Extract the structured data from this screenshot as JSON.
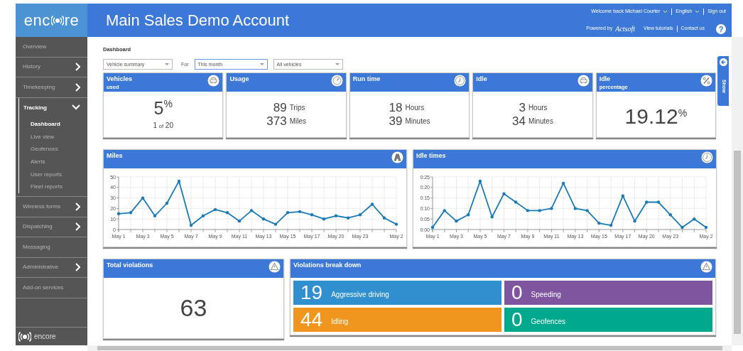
{
  "logo": {
    "text_before": "enc",
    "text_after": "re"
  },
  "title": "Main Sales Demo Account",
  "user_menu": [
    {
      "label": "Welcome back Michael Courter",
      "dropdown": true
    },
    {
      "label": "English",
      "dropdown": true
    },
    {
      "label": "Sign out",
      "dropdown": false
    }
  ],
  "powered_by": {
    "label": "Powered by",
    "brand": "Actsoft"
  },
  "header_links": [
    "View tutorials",
    "Contact us"
  ],
  "help": "?",
  "sidebar": {
    "items": [
      {
        "label": "Overview",
        "selected": false
      },
      {
        "label": "History",
        "expanded": false,
        "selected": false
      },
      {
        "label": "Timekeeping",
        "expanded": false,
        "selected": false
      },
      {
        "label": "Tracking",
        "expanded": true,
        "selected": true,
        "children": [
          {
            "label": "Dashboard",
            "selected": true
          },
          {
            "label": "Live view",
            "selected": false
          },
          {
            "label": "Geofences",
            "selected": false
          },
          {
            "label": "Alerts",
            "selected": false
          },
          {
            "label": "User reports",
            "selected": false
          },
          {
            "label": "Fleet reports",
            "selected": false
          }
        ]
      },
      {
        "label": "Wireless forms",
        "expanded": false,
        "selected": false
      },
      {
        "label": "Dispatching",
        "expanded": false,
        "selected": false
      },
      {
        "label": "Messaging",
        "selected": false
      },
      {
        "label": "Administrative",
        "expanded": false,
        "selected": false
      },
      {
        "label": "Add-on services",
        "selected": false
      }
    ],
    "footer_brand": "encore"
  },
  "breadcrumb": "Dashboard",
  "filters": [
    {
      "value": "Vehicle summary",
      "focused": false
    },
    {
      "label": "For",
      "value": "This month",
      "focused": true
    },
    {
      "value": "All vehicles",
      "focused": false
    }
  ],
  "show_tab": "Show",
  "stats": [
    {
      "kind": "percent",
      "title": "Vehicles",
      "subtitle": "used",
      "value": "5$^{%}$",
      "footnote": {
        "count": "1",
        "joiner": "of",
        "total": "20"
      }
    },
    {
      "kind": "pairs",
      "title": "Usage",
      "rows": [
        {
          "value": "89",
          "unit": "Trips"
        },
        {
          "value": "373",
          "unit": "Miles"
        }
      ]
    },
    {
      "kind": "pairs",
      "title": "Run time",
      "rows": [
        {
          "value": "18",
          "unit": "Hours"
        },
        {
          "value": "39",
          "unit": "Minutes"
        }
      ]
    },
    {
      "kind": "pairs",
      "title": "Idle",
      "rows": [
        {
          "value": "3",
          "unit": "Hours"
        },
        {
          "value": "34",
          "unit": "Minutes"
        }
      ]
    },
    {
      "kind": "percent",
      "title": "Idle",
      "subtitle": "percentage",
      "value": "19.12$^{%}$"
    }
  ],
  "charts": [
    {
      "title": "Miles",
      "chart_data": {
        "type": "line",
        "categories": [
          "May 1",
          null,
          "May 3",
          null,
          "May 5",
          null,
          "May 7",
          null,
          "May 9",
          null,
          "May 11",
          null,
          "May 13",
          null,
          "May 15",
          null,
          "May 17",
          null,
          "May 20",
          null,
          "May 23",
          null,
          null,
          "May 2"
        ],
        "series": [
          {
            "color": "#1a7ab8",
            "values": [
              15,
              16,
              30,
              13,
              25,
              46,
              4,
              13,
              19,
              16,
              8,
              18,
              10,
              5,
              16,
              17,
              14,
              10,
              13,
              11,
              14,
              24,
              11,
              5
            ]
          }
        ],
        "grid": true,
        "ylim": [
          0,
          50
        ],
        "yticks": [
          0,
          10,
          20,
          30,
          40,
          50
        ]
      }
    },
    {
      "title": "Idle times",
      "chart_data": {
        "type": "line",
        "categories": [
          "May 1",
          null,
          "May 3",
          null,
          "May 5",
          null,
          "May 7",
          null,
          "May 9",
          null,
          "May 11",
          null,
          "May 13",
          null,
          "May 15",
          null,
          "May 17",
          null,
          "May 20",
          null,
          "May 23",
          null,
          null,
          "May 2"
        ],
        "series": [
          {
            "color": "#1a7ab8",
            "values": [
              1,
              9,
              4,
              7,
              23,
              6,
              17,
              13,
              9,
              9,
              10,
              22,
              10,
              9,
              3,
              2,
              16,
              4,
              13,
              13,
              7,
              1,
              5,
              1
            ]
          }
        ],
        "grid": true,
        "ylim": [
          0,
          25
        ],
        "yticks": [
          {
            "value": 0,
            "label": "0:00"
          },
          {
            "value": 5,
            "label": "0:05"
          },
          {
            "value": 10,
            "label": "0:10"
          },
          {
            "value": 15,
            "label": "0:15"
          },
          {
            "value": 20,
            "label": "0:20"
          },
          {
            "value": 25,
            "label": "0:25"
          }
        ]
      }
    }
  ],
  "total_violations": {
    "title": "Total violations",
    "value": "63"
  },
  "breakdown": {
    "title": "Violations break down",
    "tiles": [
      {
        "value": "19",
        "label": "Aggressive driving",
        "color": "#3090cf"
      },
      {
        "value": "0",
        "label": "Speeding",
        "color": "#7f55a0"
      },
      {
        "value": "44",
        "label": "Idling",
        "color": "#f0951e"
      },
      {
        "value": "0",
        "label": "Geofences",
        "color": "#00a88e"
      }
    ]
  }
}
